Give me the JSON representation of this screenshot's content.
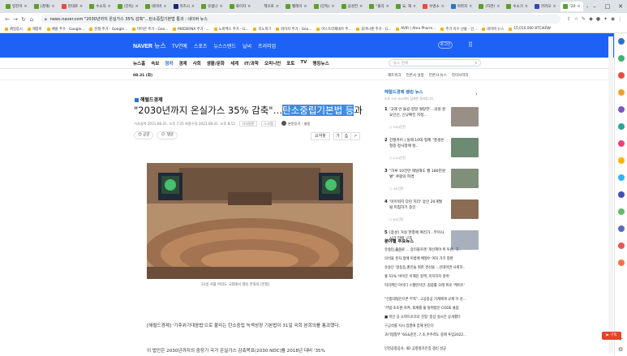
{
  "browser": {
    "tabs": [
      {
        "label": "일진어",
        "color": "#5aa02c",
        "active": false
      },
      {
        "label": "(경제)",
        "color": "#5aa02c",
        "active": false
      },
      {
        "label": "현대로",
        "color": "#e74c3c",
        "active": false
      },
      {
        "label": "수소차",
        "color": "#5aa02c",
        "active": false
      },
      {
        "label": "(단독)",
        "color": "#5aa02c",
        "active": false
      },
      {
        "label": "네이버",
        "color": "#5aa02c",
        "active": false
      },
      {
        "label": "미즈시",
        "color": "#1a237e",
        "active": false
      },
      {
        "label": "유럽나",
        "color": "#5aa02c",
        "active": false
      },
      {
        "label": "화이자",
        "color": "#5aa02c",
        "active": false
      },
      {
        "label": "책으로",
        "color": "#e0e0e0",
        "active": false
      },
      {
        "label": "펠레이",
        "color": "#5aa02c",
        "active": false
      },
      {
        "label": "(단독)",
        "color": "#5aa02c",
        "active": false
      },
      {
        "label": "삼성전",
        "color": "#5aa02c",
        "active": false
      },
      {
        "label": "\"출각",
        "color": "#5aa02c",
        "active": false
      },
      {
        "label": "요, 해",
        "color": "#5aa02c",
        "active": false
      },
      {
        "label": "수명소",
        "color": "#e74c3c",
        "active": false
      },
      {
        "label": "아파지",
        "color": "#2a72c9",
        "active": false
      },
      {
        "label": "(자연)",
        "color": "#5aa02c",
        "active": false
      },
      {
        "label": "수소기",
        "color": "#5aa02c",
        "active": false
      },
      {
        "label": "카카오",
        "color": "#3949ab",
        "active": false
      },
      {
        "label": "\"20",
        "color": "#5aa02c",
        "active": true
      }
    ],
    "url": "news.naver.com \"2030년까지 온실가스 35% 감축\"…탄소중립기본법 통과 : 네이버 뉴스",
    "bookmarks": [
      "제일증시",
      "해봉마",
      "애플 주가 - Google...",
      "진철 주가 - Google...",
      "마이콘 주가 - Goo...",
      "MODERNA 주가 -...",
      "노바백스 주가 - G...",
      "지노피크",
      "화이자 주가 - Goo...",
      "아스트라제네카 주...",
      "휴마나젠 주가 - G...",
      "AVIR | Atea Pharm...",
      "주가 지수 선물 - 인...",
      "네이버 뉴스",
      "15,010,000 BTC/KRW"
    ]
  },
  "naver": {
    "logo": "NAVER",
    "logo_sub": "뉴스",
    "menu": [
      "TV연예",
      "스포츠",
      "뉴스스탠드",
      "날씨",
      "프리미엄"
    ],
    "login": "로그인",
    "categories": [
      "뉴스홈",
      "속보",
      "정치",
      "경제",
      "사회",
      "생활/문화",
      "세계",
      "IT/과학",
      "오피니언",
      "포토",
      "TV",
      "랭킹뉴스"
    ],
    "active_category": "정치",
    "search_placeholder": "뉴스 검색",
    "date": "08.31 (화)",
    "top_links": [
      "제트워크",
      "언론사 설정",
      "언론사 뉴스",
      "라이브러리"
    ]
  },
  "article": {
    "press": "헤럴드경제",
    "headline_pre": "\"2030년까지 온실가스 35% 감축\"…",
    "headline_highlight": "탄소중립기본법 등",
    "headline_post": "과",
    "meta": "기사입력 2021.08.31. 오후 7:25  최종수정 2021.08.31. 오후 8:12",
    "tags": [
      "기사원문",
      "스크랩"
    ],
    "reporter": "본문듣기 - 설정",
    "actions": [
      "공감",
      "댓글"
    ],
    "tools": [
      "요약봇",
      "가",
      "⎙",
      "↗"
    ],
    "caption": "31일 서울 여의도 국회에서 열린 본회의 [연합]",
    "body1": "[헤럴드경제] '기후위기대응법'으로 불리는 탄소중립 녹색성장 기본법이 31일 국회 본회의를 통과했다.",
    "body2": "이 법안은 2030년까지의 중장기 국가 온실가스 감축목표(2030 NDC)를 2018년 대비 '35%"
  },
  "ranking": {
    "title": "헤럴드경제 랭킹 뉴스",
    "subtitle": "오후 7시~8시까지 집계한 결과입니다.",
    "items": [
      {
        "num": "1",
        "title": "'고래 안 들길 정말 절망한'…의원 분요인신, 신규확진 지정...",
        "count": "15시간전",
        "thumb": "#9a8f86"
      },
      {
        "num": "2",
        "title": "진철카어 | 실제 10대 형제 \"총생은 형종·정사정에 뒀..",
        "count": "11시간전",
        "thumb": "#6d8a73"
      },
      {
        "num": "3",
        "title": "\"하루 10건만 해달해도 월 180만원 벌\" 쿠팡의 파격",
        "count": "4시간전",
        "thumb": "#7f8f7a"
      },
      {
        "num": "4",
        "title": "'미이워지 다린 지리' 승인 20개월 될 피침하기 중인",
        "count": "6시간전",
        "thumb": "#8a6c55"
      },
      {
        "num": "5",
        "title": "[종성] 거실 한창에 여러가...부아사 시간 만에 구조",
        "count": "6시간전",
        "thumb": "#a7b0bc"
      }
    ]
  },
  "popular": {
    "title": "분야별 주요뉴스",
    "items": [
      "유송인 출운로 ... 승리물프랜 '개선헤야 위 투년, 국...",
      "의석을 훈자 형에 이름에 배쩡수 여자 가기 청판",
      "유송인 '정동동,퀀민슬 위한 경산을 ...인데이면 사회하..",
      "홍 51% '바이든 이해진 정책, 지지하지 않아'",
      "허리케인 아이다 스켈련지만..접종률 모래 위로 '케이트'",
      "\"신종데릴인으론 부족\"...2공중공 기계에게 규제 이 강...",
      "'키법·조조원·과켜, 회계를 물 탈취법인 CODE 클럽",
      "■ 락인 응 소마트로코로 진형 '중상 실시간 공개했다",
      "구금석를 지시 업결에 집해 판단다",
      "과기형통부 '6G&준인..7,조,주주력도 중에 투입2022..."
    ],
    "footer": "인천공항공사, 4D 공항평가인증 갱신 성공"
  },
  "sidebar": {
    "icons": [
      {
        "name": "blue",
        "color": "#2a72c9"
      },
      {
        "name": "green",
        "color": "#3cb371"
      },
      {
        "name": "red",
        "color": "#e74c3c"
      },
      {
        "name": "orange",
        "color": "#f0a030"
      },
      {
        "name": "purple",
        "color": "#7e57c2"
      },
      {
        "name": "teal",
        "color": "#26a69a"
      },
      {
        "name": "pink",
        "color": "#ec407a"
      },
      {
        "name": "amber",
        "color": "#ffb300"
      },
      {
        "name": "sky",
        "color": "#29b6f6"
      },
      {
        "name": "blue2",
        "color": "#3f51b5"
      },
      {
        "name": "green2",
        "color": "#66bb6a"
      },
      {
        "name": "indigo",
        "color": "#5c6bc0"
      },
      {
        "name": "red2",
        "color": "#ef5350"
      },
      {
        "name": "orange2",
        "color": "#ff7043"
      }
    ],
    "subscribe": "▶ 구독"
  }
}
